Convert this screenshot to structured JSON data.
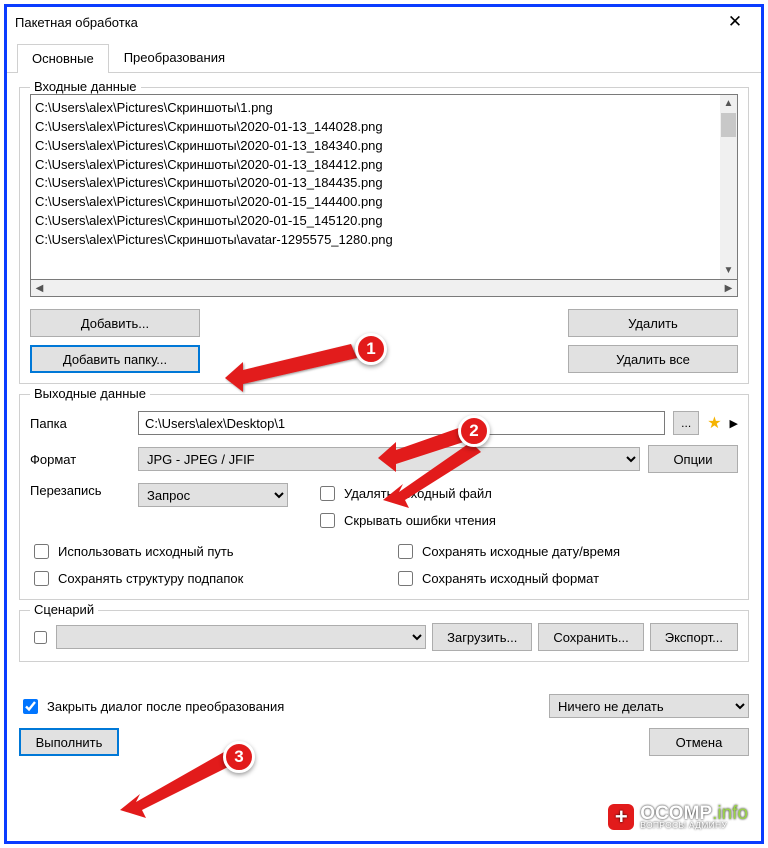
{
  "window": {
    "title": "Пакетная обработка"
  },
  "tabs": {
    "main": "Основные",
    "transform": "Преобразования"
  },
  "input": {
    "legend": "Входные данные",
    "files": [
      "C:\\Users\\alex\\Pictures\\Скриншоты\\1.png",
      "C:\\Users\\alex\\Pictures\\Скриншоты\\2020-01-13_144028.png",
      "C:\\Users\\alex\\Pictures\\Скриншоты\\2020-01-13_184340.png",
      "C:\\Users\\alex\\Pictures\\Скриншоты\\2020-01-13_184412.png",
      "C:\\Users\\alex\\Pictures\\Скриншоты\\2020-01-13_184435.png",
      "C:\\Users\\alex\\Pictures\\Скриншоты\\2020-01-15_144400.png",
      "C:\\Users\\alex\\Pictures\\Скриншоты\\2020-01-15_145120.png",
      "C:\\Users\\alex\\Pictures\\Скриншоты\\avatar-1295575_1280.png"
    ],
    "add": "Добавить...",
    "addFolder": "Добавить папку...",
    "remove": "Удалить",
    "removeAll": "Удалить все"
  },
  "output": {
    "legend": "Выходные данные",
    "folderLabel": "Папка",
    "folderValue": "C:\\Users\\alex\\Desktop\\1",
    "browse": "...",
    "formatLabel": "Формат",
    "formatValue": "JPG - JPEG / JFIF",
    "options": "Oпции",
    "overwriteLabel": "Перезапись",
    "overwriteValue": "Запрос",
    "chk": {
      "useSrcPath": "Использовать исходный путь",
      "keepSubfolders": "Сохранять структуру подпапок",
      "deleteSrc": "Удалять исходный файл",
      "hideReadErr": "Скрывать ошибки чтения",
      "keepDate": "Сохранять исходные дату/время",
      "keepFormat": "Сохранять исходный формат"
    }
  },
  "scenario": {
    "legend": "Сценарий",
    "load": "Загрузить...",
    "save": "Сохранить...",
    "export": "Экспорт..."
  },
  "footer": {
    "closeAfter": "Закрыть диалог после преобразования",
    "afterAction": "Ничего не делать",
    "execute": "Выполнить",
    "cancel": "Отмена"
  },
  "marks": {
    "m1": "1",
    "m2": "2",
    "m3": "3"
  },
  "watermark": {
    "brand": "OCOMP",
    "suffix": ".info",
    "sub": "ВОПРОСЫ АДМИНУ"
  }
}
